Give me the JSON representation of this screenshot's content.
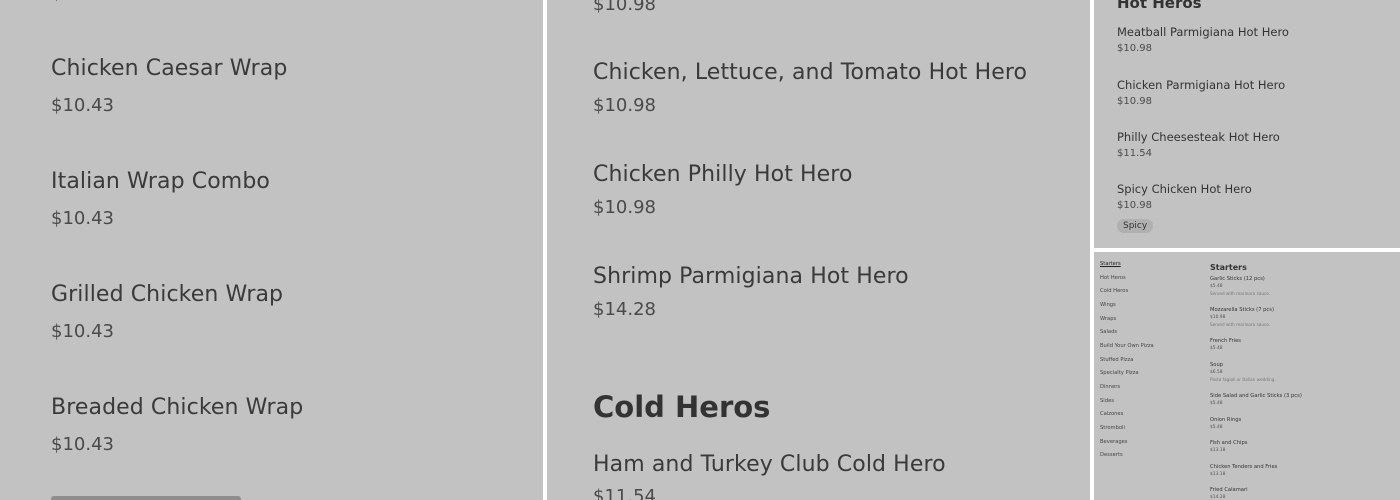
{
  "left_panel": {
    "items": [
      {
        "name": "Chicken Caesar Wrap",
        "price": "$10.43"
      },
      {
        "name": "Italian Wrap Combo",
        "price": "$10.43"
      },
      {
        "name": "Grilled Chicken Wrap",
        "price": "$10.43"
      },
      {
        "name": "Breaded Chicken Wrap",
        "price": "$10.43"
      }
    ]
  },
  "mid_panel": {
    "top_price": "$10.98",
    "items": [
      {
        "name": "Chicken, Lettuce, and Tomato Hot Hero",
        "price": "$10.98"
      },
      {
        "name": "Chicken Philly Hot Hero",
        "price": "$10.98"
      },
      {
        "name": "Shrimp Parmigiana Hot Hero",
        "price": "$14.28"
      }
    ],
    "section_heading": "Cold Heros",
    "cold_items": [
      {
        "name": "Ham and Turkey Club Cold Hero",
        "price": "$11.54"
      }
    ]
  },
  "top_right_panel": {
    "heading": "Hot Heros",
    "items": [
      {
        "name": "Meatball Parmigiana Hot Hero",
        "price": "$10.98"
      },
      {
        "name": "Chicken Parmigiana Hot Hero",
        "price": "$10.98"
      },
      {
        "name": "Philly Cheesesteak Hot Hero",
        "price": "$11.54"
      },
      {
        "name": "Spicy Chicken Hot Hero",
        "price": "$10.98"
      }
    ],
    "badge": "Spicy"
  },
  "bottom_right_panel": {
    "sidebar": [
      "Starters",
      "Hot Heros",
      "Cold Heros",
      "Wings",
      "Wraps",
      "Salads",
      "Build Your Own Pizza",
      "Stuffed Pizza",
      "Specialty Pizza",
      "Dinners",
      "Sides",
      "Calzones",
      "Stromboli",
      "Beverages",
      "Desserts"
    ],
    "heading": "Starters",
    "items": [
      {
        "name": "Garlic Sticks (12 pcs)",
        "price": "$5.48",
        "desc": "Served with marinara sauce."
      },
      {
        "name": "Mozzarella Sticks (7 pcs)",
        "price": "$10.98",
        "desc": "Served with marinara sauce."
      },
      {
        "name": "French Fries",
        "price": "$5.48",
        "desc": ""
      },
      {
        "name": "Soup",
        "price": "$6.58",
        "desc": "Pasta fagioli or Italian wedding."
      },
      {
        "name": "Side Salad and Garlic Sticks (3 pcs)",
        "price": "$5.48",
        "desc": ""
      },
      {
        "name": "Onion Rings",
        "price": "$5.48",
        "desc": ""
      },
      {
        "name": "Fish and Chips",
        "price": "$13.18",
        "desc": ""
      },
      {
        "name": "Chicken Tenders and Fries",
        "price": "$13.18",
        "desc": ""
      },
      {
        "name": "Fried Calamari",
        "price": "$14.28",
        "desc": ""
      }
    ]
  }
}
